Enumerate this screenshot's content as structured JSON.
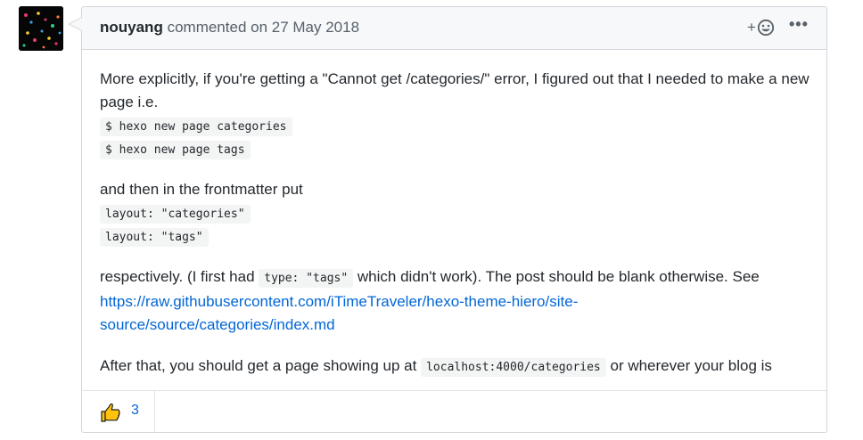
{
  "comment": {
    "author": "nouyang",
    "meta": "commented on 27 May 2018",
    "add_reaction_label": "+",
    "more_label": "•••",
    "paragraph1": "More explicitly, if you're getting a \"Cannot get /categories/\" error, I figured out that I needed to make a new page i.e.",
    "code1": "$ hexo new page categories",
    "code2": "$ hexo new page tags",
    "paragraph2": "and then in the frontmatter put",
    "code3": "layout: \"categories\"",
    "code4": "layout: \"tags\"",
    "paragraph3_before": "respectively. (I first had ",
    "paragraph3_code": "type: \"tags\"",
    "paragraph3_after": " which didn't work). The post should be blank otherwise. See ",
    "link_part1": "https://raw.githubusercontent.com/iTimeTraveler/hexo-theme-hiero/site-",
    "link_part2": "source/source/categories/index.md",
    "paragraph4_before": "After that, you should get a page showing up at ",
    "paragraph4_code": "localhost:4000/categories",
    "paragraph4_after": " or wherever your blog is",
    "reactions": [
      {
        "icon": "thumbs-up-icon",
        "count": "3"
      }
    ]
  },
  "colors": {
    "accent": "#0366d6",
    "header_bg": "#f6f8fa",
    "border": "#d1d5da",
    "thumbs": "#ffc30b"
  }
}
